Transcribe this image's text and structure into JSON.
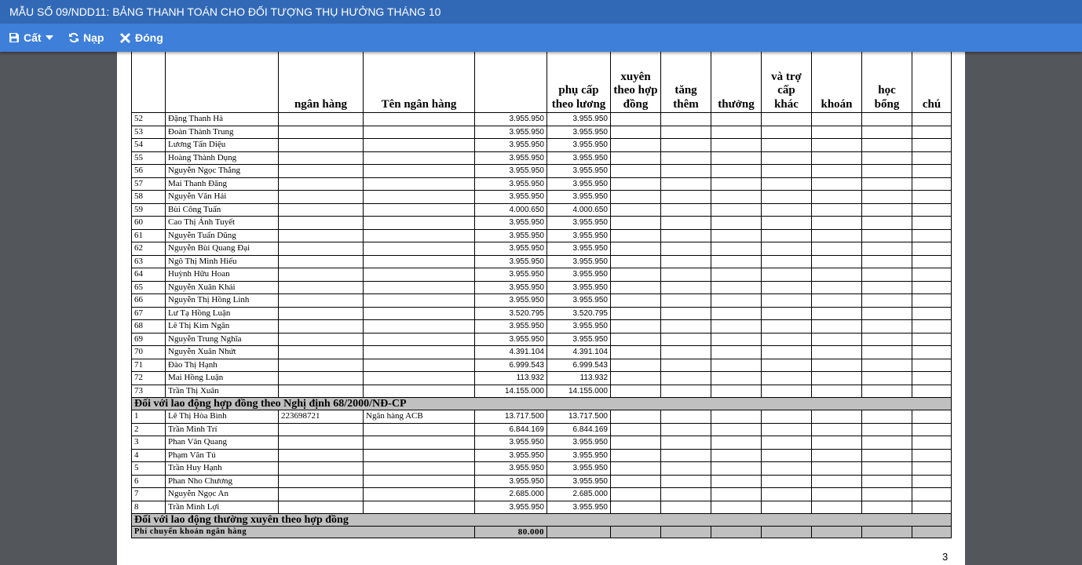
{
  "window": {
    "title": "MẪU SỐ 09/NDD11: BẢNG THANH TOÁN CHO ĐỐI TƯỢNG THỤ HƯỞNG THÁNG 10"
  },
  "toolbar": {
    "save_label": "Cất",
    "reload_label": "Nạp",
    "close_label": "Đóng"
  },
  "icons": {
    "save": "floppy-disk-icon",
    "dropdown": "caret-down-icon",
    "reload": "refresh-icon",
    "close": "close-x-icon"
  },
  "colors": {
    "titlebar": "#3269b6",
    "toolbar": "#3e7fd9",
    "background": "#53565a",
    "section_fill": "#c0c0c0"
  },
  "report": {
    "headers": [
      "",
      "",
      "ngân hàng",
      "Tên ngân hàng",
      "",
      "phụ cấp theo lương",
      "xuyên theo hợp đồng",
      "tăng thêm",
      "thưởng",
      "và trợ cấp khác",
      "khoán",
      "học bổng",
      "chú"
    ],
    "rows_group1": [
      {
        "stt": "52",
        "name": "Đặng Thanh Hà",
        "account": "",
        "bank": "",
        "amount": "3.955.950",
        "total": "3.955.950"
      },
      {
        "stt": "53",
        "name": "Đoàn Thành Trung",
        "account": "",
        "bank": "",
        "amount": "3.955.950",
        "total": "3.955.950"
      },
      {
        "stt": "54",
        "name": "Lương Tấn Diệu",
        "account": "",
        "bank": "",
        "amount": "3.955.950",
        "total": "3.955.950"
      },
      {
        "stt": "55",
        "name": "Hoàng Thành Dụng",
        "account": "",
        "bank": "",
        "amount": "3.955.950",
        "total": "3.955.950"
      },
      {
        "stt": "56",
        "name": "Nguyễn Ngọc Thắng",
        "account": "",
        "bank": "",
        "amount": "3.955.950",
        "total": "3.955.950"
      },
      {
        "stt": "57",
        "name": "Mai Thanh Đăng",
        "account": "",
        "bank": "",
        "amount": "3.955.950",
        "total": "3.955.950"
      },
      {
        "stt": "58",
        "name": "Nguyễn Văn Hải",
        "account": "",
        "bank": "",
        "amount": "3.955.950",
        "total": "3.955.950"
      },
      {
        "stt": "59",
        "name": "Bùi Công Tuấn",
        "account": "",
        "bank": "",
        "amount": "4.000.650",
        "total": "4.000.650"
      },
      {
        "stt": "60",
        "name": "Cao Thị Ánh Tuyết",
        "account": "",
        "bank": "",
        "amount": "3.955.950",
        "total": "3.955.950"
      },
      {
        "stt": "61",
        "name": "Nguyễn Tuấn Dũng",
        "account": "",
        "bank": "",
        "amount": "3.955.950",
        "total": "3.955.950"
      },
      {
        "stt": "62",
        "name": "Nguyễn Bùi Quang Đại",
        "account": "",
        "bank": "",
        "amount": "3.955.950",
        "total": "3.955.950"
      },
      {
        "stt": "63",
        "name": "Ngô Thị Minh Hiếu",
        "account": "",
        "bank": "",
        "amount": "3.955.950",
        "total": "3.955.950"
      },
      {
        "stt": "64",
        "name": "Huỳnh Hữu Hoan",
        "account": "",
        "bank": "",
        "amount": "3.955.950",
        "total": "3.955.950"
      },
      {
        "stt": "65",
        "name": "Nguyễn Xuân Khải",
        "account": "",
        "bank": "",
        "amount": "3.955.950",
        "total": "3.955.950"
      },
      {
        "stt": "66",
        "name": "Nguyễn Thị Hồng Linh",
        "account": "",
        "bank": "",
        "amount": "3.955.950",
        "total": "3.955.950"
      },
      {
        "stt": "67",
        "name": "Lư Tạ Hồng Luận",
        "account": "",
        "bank": "",
        "amount": "3.520.795",
        "total": "3.520.795"
      },
      {
        "stt": "68",
        "name": "Lê Thị Kim Ngân",
        "account": "",
        "bank": "",
        "amount": "3.955.950",
        "total": "3.955.950"
      },
      {
        "stt": "69",
        "name": "Nguyễn Trung Nghĩa",
        "account": "",
        "bank": "",
        "amount": "3.955.950",
        "total": "3.955.950"
      },
      {
        "stt": "70",
        "name": "Nguyễn Xuân Nhứt",
        "account": "",
        "bank": "",
        "amount": "4.391.104",
        "total": "4.391.104"
      },
      {
        "stt": "71",
        "name": "Đào Thị Hạnh",
        "account": "",
        "bank": "",
        "amount": "6.999.543",
        "total": "6.999.543"
      },
      {
        "stt": "72",
        "name": "Mai Hồng Luận",
        "account": "",
        "bank": "",
        "amount": "113.932",
        "total": "113.932"
      },
      {
        "stt": "73",
        "name": "Trần Thị Xuân",
        "account": "",
        "bank": "",
        "amount": "14.155.000",
        "total": "14.155.000"
      }
    ],
    "section2_title": "Đối với lao động hợp đồng theo Nghị định 68/2000/NĐ-CP",
    "rows_group2": [
      {
        "stt": "1",
        "name": "Lê Thị Hòa Bình",
        "account": "223698721",
        "bank": "Ngân hàng ACB",
        "amount": "13.717.500",
        "total": "13.717.500"
      },
      {
        "stt": "2",
        "name": "Trần Minh Trí",
        "account": "",
        "bank": "",
        "amount": "6.844.169",
        "total": "6.844.169"
      },
      {
        "stt": "3",
        "name": "Phan Văn Quang",
        "account": "",
        "bank": "",
        "amount": "3.955.950",
        "total": "3.955.950"
      },
      {
        "stt": "4",
        "name": "Phạm Văn Tú",
        "account": "",
        "bank": "",
        "amount": "3.955.950",
        "total": "3.955.950"
      },
      {
        "stt": "5",
        "name": "Trần Huy Hạnh",
        "account": "",
        "bank": "",
        "amount": "3.955.950",
        "total": "3.955.950"
      },
      {
        "stt": "6",
        "name": "Phan Nho Chương",
        "account": "",
        "bank": "",
        "amount": "3.955.950",
        "total": "3.955.950"
      },
      {
        "stt": "7",
        "name": "Nguyễn Ngọc An",
        "account": "",
        "bank": "",
        "amount": "2.685.000",
        "total": "2.685.000"
      },
      {
        "stt": "8",
        "name": "Trần Minh Lợi",
        "account": "",
        "bank": "",
        "amount": "3.955.950",
        "total": "3.955.950"
      }
    ],
    "section3_title": "Đối với lao động thường xuyên theo hợp đồng",
    "fee_label": "Phí chuyển khoản ngân hàng",
    "fee_amount": "80.000",
    "page_number": "3"
  }
}
